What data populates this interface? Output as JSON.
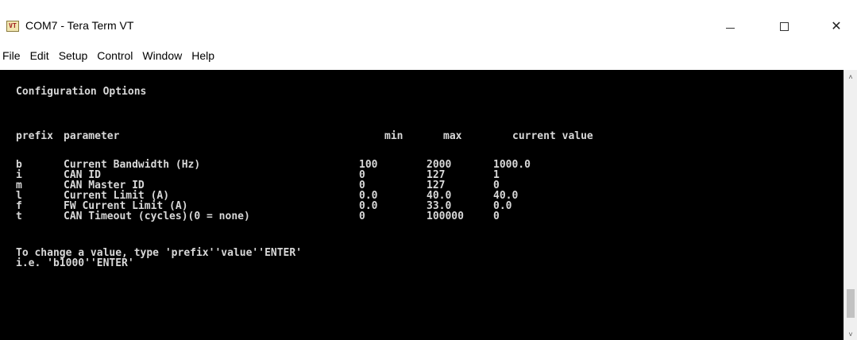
{
  "window": {
    "title": "COM7 - Tera Term VT",
    "app_icon_text": "VT",
    "controls": {
      "minimize": "—",
      "maximize": "☐",
      "close": "✕"
    }
  },
  "menu": [
    "File",
    "Edit",
    "Setup",
    "Control",
    "Window",
    "Help"
  ],
  "terminal": {
    "heading": "Configuration Options",
    "columns": {
      "prefix": "prefix",
      "parameter": "parameter",
      "min": "min",
      "max": "max",
      "current": "current value"
    },
    "rows": [
      {
        "prefix": "b",
        "parameter": "Current Bandwidth (Hz)",
        "min": "100",
        "max": "2000",
        "current": "1000.0"
      },
      {
        "prefix": "i",
        "parameter": "CAN ID",
        "min": "0",
        "max": "127",
        "current": "1"
      },
      {
        "prefix": "m",
        "parameter": "CAN Master ID",
        "min": "0",
        "max": "127",
        "current": "0"
      },
      {
        "prefix": "l",
        "parameter": "Current Limit (A)",
        "min": "0.0",
        "max": "40.0",
        "current": "40.0"
      },
      {
        "prefix": "f",
        "parameter": "FW Current Limit (A)",
        "min": "0.0",
        "max": "33.0",
        "current": "0.0"
      },
      {
        "prefix": "t",
        "parameter": "CAN Timeout (cycles)(0 = none)",
        "min": "0",
        "max": "100000",
        "current": "0"
      }
    ],
    "instructions": [
      "To change a value, type 'prefix''value''ENTER'",
      "i.e. 'b1000''ENTER'"
    ]
  },
  "scrollbar": {
    "up_arrow": "˄",
    "down_arrow": "˅"
  }
}
